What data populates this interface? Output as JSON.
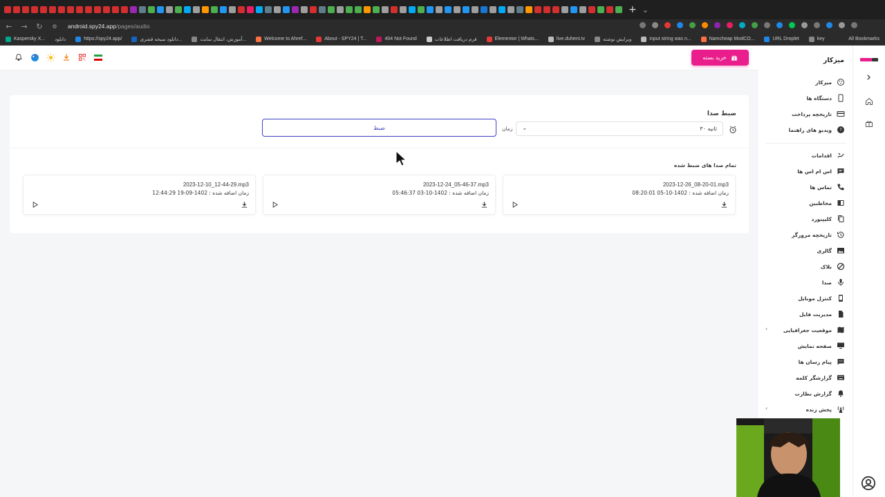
{
  "browser": {
    "url_host": "android.spy24.app",
    "url_path": "/pages/audio",
    "bookmarks": [
      "Kaspersky X...",
      "دانلود",
      "https://spy24.app/",
      "دانلود سیحه قشری...",
      "آموزش، انتقال سایت...",
      "Welcome to Ahref...",
      "About - SPY24 | T...",
      "404 Not Found",
      "فرم دریافت اطلاعات",
      "Elementor | Whats...",
      "live.duhent.tv",
      "ویرایش نوشته",
      "input string was n...",
      "Namcheap ModCO...",
      "URL Droplet",
      "key"
    ],
    "all_bookmarks": "All Bookmarks"
  },
  "sidebar": {
    "title": "میزکار",
    "items": [
      {
        "label": "میزکار",
        "icon": "dashboard-icon"
      },
      {
        "label": "دستگاه ها",
        "icon": "phone-icon"
      },
      {
        "label": "تاریخچه پرداخت",
        "icon": "credit-card-icon"
      },
      {
        "label": "ویدیو های راهنما",
        "icon": "help-icon"
      },
      {
        "label": "اقدامات",
        "icon": "actions-icon"
      },
      {
        "label": "اس ام اس ها",
        "icon": "sms-icon"
      },
      {
        "label": "تماس ها",
        "icon": "call-icon"
      },
      {
        "label": "مخاطبین",
        "icon": "contacts-icon"
      },
      {
        "label": "کلیپبورد",
        "icon": "clipboard-icon"
      },
      {
        "label": "تاریخچه مرورگر",
        "icon": "history-icon"
      },
      {
        "label": "گالری",
        "icon": "gallery-icon"
      },
      {
        "label": "بلاک",
        "icon": "block-icon"
      },
      {
        "label": "صدا",
        "icon": "microphone-icon"
      },
      {
        "label": "کنترل موبایل",
        "icon": "mobile-control-icon"
      },
      {
        "label": "مدیریت فایل",
        "icon": "file-icon"
      },
      {
        "label": "موقعیت جغرافیایی",
        "icon": "map-icon"
      },
      {
        "label": "صفحه نمایش",
        "icon": "monitor-icon"
      },
      {
        "label": "پیام رسان ها",
        "icon": "messenger-icon"
      },
      {
        "label": "گزارشگر کلمه",
        "icon": "keyboard-icon"
      },
      {
        "label": "گزارش نظارت",
        "icon": "bell-icon"
      },
      {
        "label": "پخش زنده",
        "icon": "live-icon"
      }
    ]
  },
  "topbar": {
    "buy_label": "خرید بسته"
  },
  "recorder": {
    "title": "ضبط صدا",
    "time_label": "زمان",
    "time_value": "۳۰ ثانیه",
    "record_label": "ضبط",
    "list_title": "تمام صدا های ضبط شده"
  },
  "recordings": [
    {
      "name": "2023-12-26_08-20-01.mp3",
      "date": "زمان اضافه شده : 1402-10-05 08:20:01"
    },
    {
      "name": "2023-12-24_05-46-37.mp3",
      "date": "زمان اضافه شده : 1402-10-03 05:46:37"
    },
    {
      "name": "2023-12-10_12-44-29.mp3",
      "date": "زمان اضافه شده : 1402-09-19 12:44:29"
    }
  ],
  "colors": {
    "accent": "#e91e8c",
    "primary": "#3d3fc4"
  }
}
